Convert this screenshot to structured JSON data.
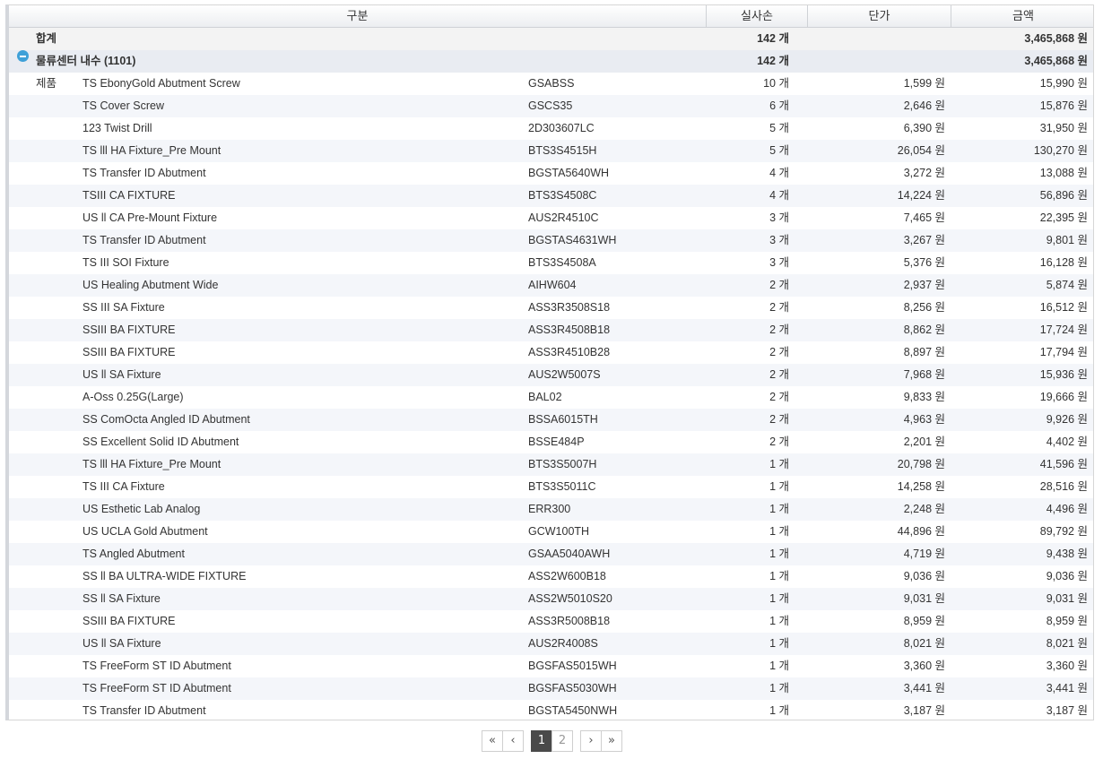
{
  "headers": {
    "category": "구분",
    "qty": "실사손",
    "price": "단가",
    "amount": "금액"
  },
  "total": {
    "label": "합계",
    "qty": "142 개",
    "amount": "3,465,868 원"
  },
  "group": {
    "label": "물류센터 내수 (1101)",
    "qty": "142 개",
    "amount": "3,465,868 원"
  },
  "kind_label": "제품",
  "rows": [
    {
      "name": "TS EbonyGold Abutment Screw",
      "code": "GSABSS",
      "qty": "10 개",
      "price": "1,599 원",
      "amount": "15,990 원"
    },
    {
      "name": "TS Cover Screw",
      "code": "GSCS35",
      "qty": "6 개",
      "price": "2,646 원",
      "amount": "15,876 원"
    },
    {
      "name": "123 Twist Drill",
      "code": "2D303607LC",
      "qty": "5 개",
      "price": "6,390 원",
      "amount": "31,950 원"
    },
    {
      "name": "TS lll HA Fixture_Pre Mount",
      "code": "BTS3S4515H",
      "qty": "5 개",
      "price": "26,054 원",
      "amount": "130,270 원"
    },
    {
      "name": "TS Transfer ID Abutment",
      "code": "BGSTA5640WH",
      "qty": "4 개",
      "price": "3,272 원",
      "amount": "13,088 원"
    },
    {
      "name": "TSIII CA FIXTURE",
      "code": "BTS3S4508C",
      "qty": "4 개",
      "price": "14,224 원",
      "amount": "56,896 원"
    },
    {
      "name": "US ll CA Pre-Mount Fixture",
      "code": "AUS2R4510C",
      "qty": "3 개",
      "price": "7,465 원",
      "amount": "22,395 원"
    },
    {
      "name": "TS Transfer ID Abutment",
      "code": "BGSTAS4631WH",
      "qty": "3 개",
      "price": "3,267 원",
      "amount": "9,801 원"
    },
    {
      "name": "TS III SOI Fixture",
      "code": "BTS3S4508A",
      "qty": "3 개",
      "price": "5,376 원",
      "amount": "16,128 원"
    },
    {
      "name": "US Healing Abutment Wide",
      "code": "AIHW604",
      "qty": "2 개",
      "price": "2,937 원",
      "amount": "5,874 원"
    },
    {
      "name": "SS III SA Fixture",
      "code": "ASS3R3508S18",
      "qty": "2 개",
      "price": "8,256 원",
      "amount": "16,512 원"
    },
    {
      "name": "SSIII BA FIXTURE",
      "code": "ASS3R4508B18",
      "qty": "2 개",
      "price": "8,862 원",
      "amount": "17,724 원"
    },
    {
      "name": "SSIII BA FIXTURE",
      "code": "ASS3R4510B28",
      "qty": "2 개",
      "price": "8,897 원",
      "amount": "17,794 원"
    },
    {
      "name": "US ll SA Fixture",
      "code": "AUS2W5007S",
      "qty": "2 개",
      "price": "7,968 원",
      "amount": "15,936 원"
    },
    {
      "name": "A-Oss 0.25G(Large)",
      "code": "BAL02",
      "qty": "2 개",
      "price": "9,833 원",
      "amount": "19,666 원"
    },
    {
      "name": "SS ComOcta Angled ID Abutment",
      "code": "BSSA6015TH",
      "qty": "2 개",
      "price": "4,963 원",
      "amount": "9,926 원"
    },
    {
      "name": "SS Excellent Solid ID Abutment",
      "code": "BSSE484P",
      "qty": "2 개",
      "price": "2,201 원",
      "amount": "4,402 원"
    },
    {
      "name": "TS lll HA Fixture_Pre Mount",
      "code": "BTS3S5007H",
      "qty": "1 개",
      "price": "20,798 원",
      "amount": "41,596 원"
    },
    {
      "name": "TS III CA Fixture",
      "code": "BTS3S5011C",
      "qty": "1 개",
      "price": "14,258 원",
      "amount": "28,516 원"
    },
    {
      "name": "US Esthetic Lab Analog",
      "code": "ERR300",
      "qty": "1 개",
      "price": "2,248 원",
      "amount": "4,496 원"
    },
    {
      "name": "US UCLA Gold Abutment",
      "code": "GCW100TH",
      "qty": "1 개",
      "price": "44,896 원",
      "amount": "89,792 원"
    },
    {
      "name": "TS Angled Abutment",
      "code": "GSAA5040AWH",
      "qty": "1 개",
      "price": "4,719 원",
      "amount": "9,438 원"
    },
    {
      "name": "SS ll BA ULTRA-WIDE FIXTURE",
      "code": "ASS2W600B18",
      "qty": "1 개",
      "price": "9,036 원",
      "amount": "9,036 원"
    },
    {
      "name": "SS ll SA Fixture",
      "code": "ASS2W5010S20",
      "qty": "1 개",
      "price": "9,031 원",
      "amount": "9,031 원"
    },
    {
      "name": "SSIII BA FIXTURE",
      "code": "ASS3R5008B18",
      "qty": "1 개",
      "price": "8,959 원",
      "amount": "8,959 원"
    },
    {
      "name": "US ll SA Fixture",
      "code": "AUS2R4008S",
      "qty": "1 개",
      "price": "8,021 원",
      "amount": "8,021 원"
    },
    {
      "name": "TS FreeForm ST ID Abutment",
      "code": "BGSFAS5015WH",
      "qty": "1 개",
      "price": "3,360 원",
      "amount": "3,360 원"
    },
    {
      "name": "TS FreeForm ST ID Abutment",
      "code": "BGSFAS5030WH",
      "qty": "1 개",
      "price": "3,441 원",
      "amount": "3,441 원"
    },
    {
      "name": "TS Transfer ID Abutment",
      "code": "BGSTA5450NWH",
      "qty": "1 개",
      "price": "3,187 원",
      "amount": "3,187 원"
    }
  ],
  "pager": {
    "first": "«",
    "prev": "‹",
    "pages": [
      "1",
      "2"
    ],
    "current": "1",
    "next": "›",
    "last": "»"
  }
}
